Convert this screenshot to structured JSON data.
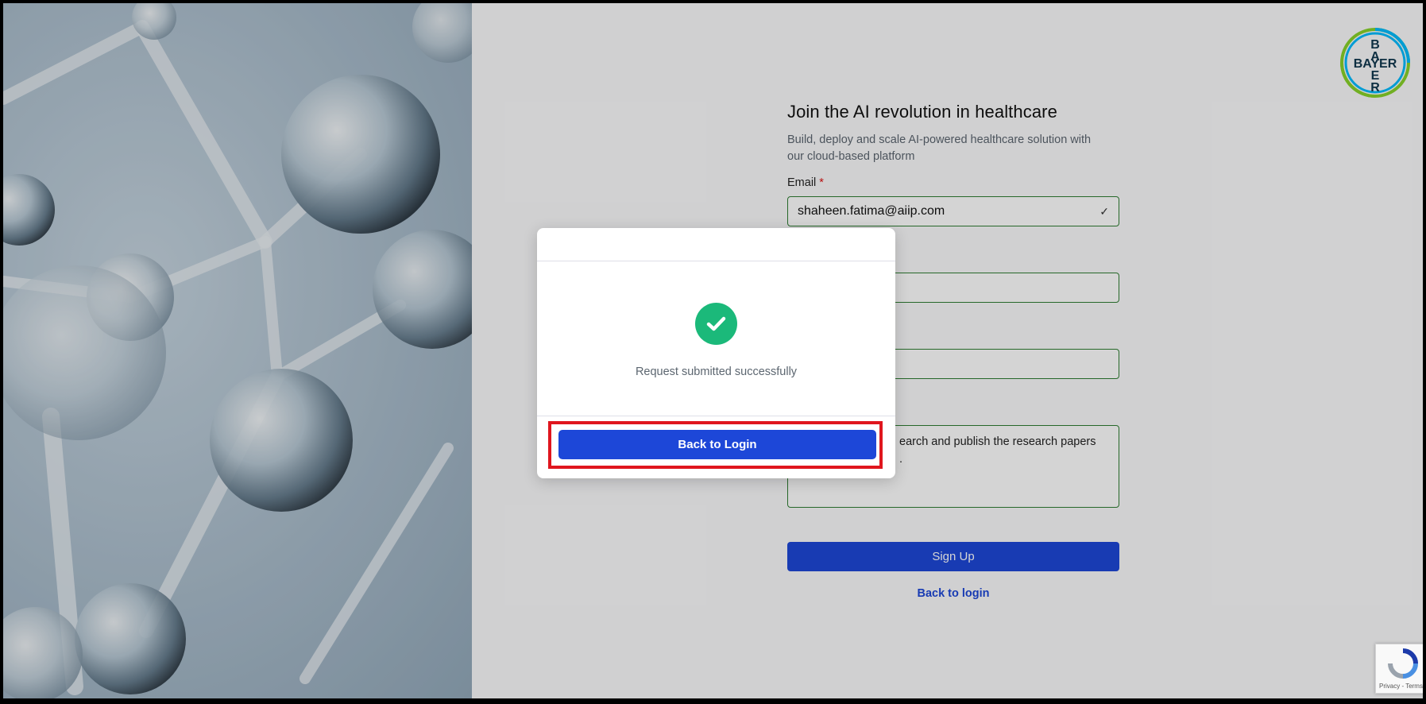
{
  "form": {
    "title": "Join the AI revolution in healthcare",
    "subtitle_line1": "Build, deploy and scale AI-powered healthcare solution with",
    "subtitle_line2": "our cloud-based platform",
    "email_label": "Email",
    "email_required_marker": "*",
    "email_value": "shaheen.fatima@aiip.com",
    "textarea_value_line1": "earch and publish the research papers",
    "textarea_value_line2": ".",
    "signup_label": "Sign Up",
    "back_link_label": "Back to login"
  },
  "logo": {
    "vertical_letters": [
      "B",
      "A",
      "E",
      "R"
    ],
    "horizontal_text": "BAYER",
    "colors": {
      "outer_ring": "#89d329",
      "inner_ring": "#00bcff",
      "text": "#10384f"
    }
  },
  "modal": {
    "message": "Request submitted successfully",
    "button_label": "Back to Login",
    "icon": "check-circle-icon",
    "icon_color": "#1bb97a",
    "highlight_color": "#e0161e"
  },
  "recaptcha": {
    "terms_text": "Privacy - Terms"
  },
  "colors": {
    "primary": "#1d47d8",
    "success": "#1bb97a",
    "field_border": "#2e7d32"
  }
}
